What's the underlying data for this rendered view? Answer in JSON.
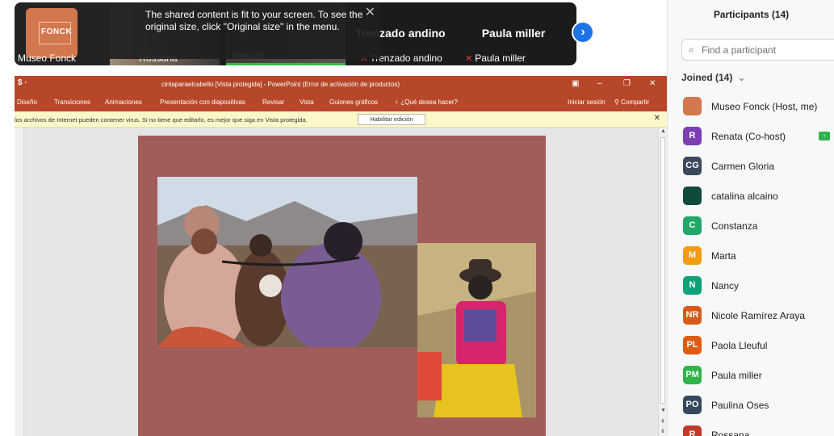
{
  "video_strip": {
    "share_notice": "The shared content is fit to your screen. To see the original size, click \"Original size\" in the menu.",
    "tiles": [
      {
        "name": "Museo Fonck",
        "logo_text": "FONCK"
      },
      {
        "name": "Rossana"
      },
      {
        "name": "Renata"
      },
      {
        "name": "Trenzado andino",
        "big": "Trenzado andino"
      },
      {
        "name": "Paula miller",
        "big": "Paula miller"
      }
    ]
  },
  "ppt": {
    "title": "cintaparaelcabello [Vista protegida] - PowerPoint (Error de activación de productos)",
    "tabs": [
      "Diseño",
      "Transiciones",
      "Animaciones",
      "Presentación con diapositivas",
      "Revisar",
      "Vista",
      "Guiones gráficos"
    ],
    "tell_me": "¿Qué desea hacer?",
    "signin": "Iniciar sesión",
    "share": "Compartir",
    "message": "los archivos de Internet pueden contener virus. Si no tiene que editarlo, es mejor que siga en Vista protegida.",
    "enable_editing": "Habilitar edición"
  },
  "panel": {
    "title": "Participants (14)",
    "search_placeholder": "Find a participant",
    "joined_label": "Joined (14)",
    "participants": [
      {
        "initials": "",
        "name": "Museo Fonck (Host, me)",
        "color": "#d3774d"
      },
      {
        "initials": "R",
        "name": "Renata (Co-host)",
        "color": "#7b3fb4"
      },
      {
        "initials": "CG",
        "name": "Carmen Gloria",
        "color": "#3b4a5a"
      },
      {
        "initials": "",
        "name": "catalina alcaino",
        "color": "#0f4a3c"
      },
      {
        "initials": "C",
        "name": "Constanza",
        "color": "#1fa868"
      },
      {
        "initials": "M",
        "name": "Marta",
        "color": "#f29c12"
      },
      {
        "initials": "N",
        "name": "Nancy",
        "color": "#11a179"
      },
      {
        "initials": "NR",
        "name": "Nicole Ramírez Araya",
        "color": "#d85a1a"
      },
      {
        "initials": "PL",
        "name": "Paola Lleuful",
        "color": "#df5b12"
      },
      {
        "initials": "PM",
        "name": "Paula miller",
        "color": "#2fb34a"
      },
      {
        "initials": "PO",
        "name": "Paulina Oses",
        "color": "#34495e"
      },
      {
        "initials": "R",
        "name": "Rossana",
        "color": "#c0392b"
      }
    ]
  }
}
